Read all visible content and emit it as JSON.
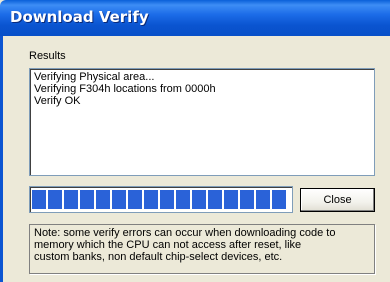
{
  "window": {
    "title": "Download Verify"
  },
  "results": {
    "label": "Results",
    "lines": [
      "Verifying Physical area...",
      "Verifying F304h locations from 0000h",
      "Verify OK"
    ]
  },
  "progress": {
    "value": 1.0
  },
  "buttons": {
    "close_label": "Close"
  },
  "note": {
    "lines": [
      "Note: some verify errors can occur when downloading code to",
      "memory which the CPU can not access after reset, like",
      "custom banks, non default chip-select devices, etc."
    ]
  },
  "colors": {
    "titlebar": "#0a54d0",
    "progress_fill": "#2a62d8",
    "face": "#ece9d8"
  }
}
